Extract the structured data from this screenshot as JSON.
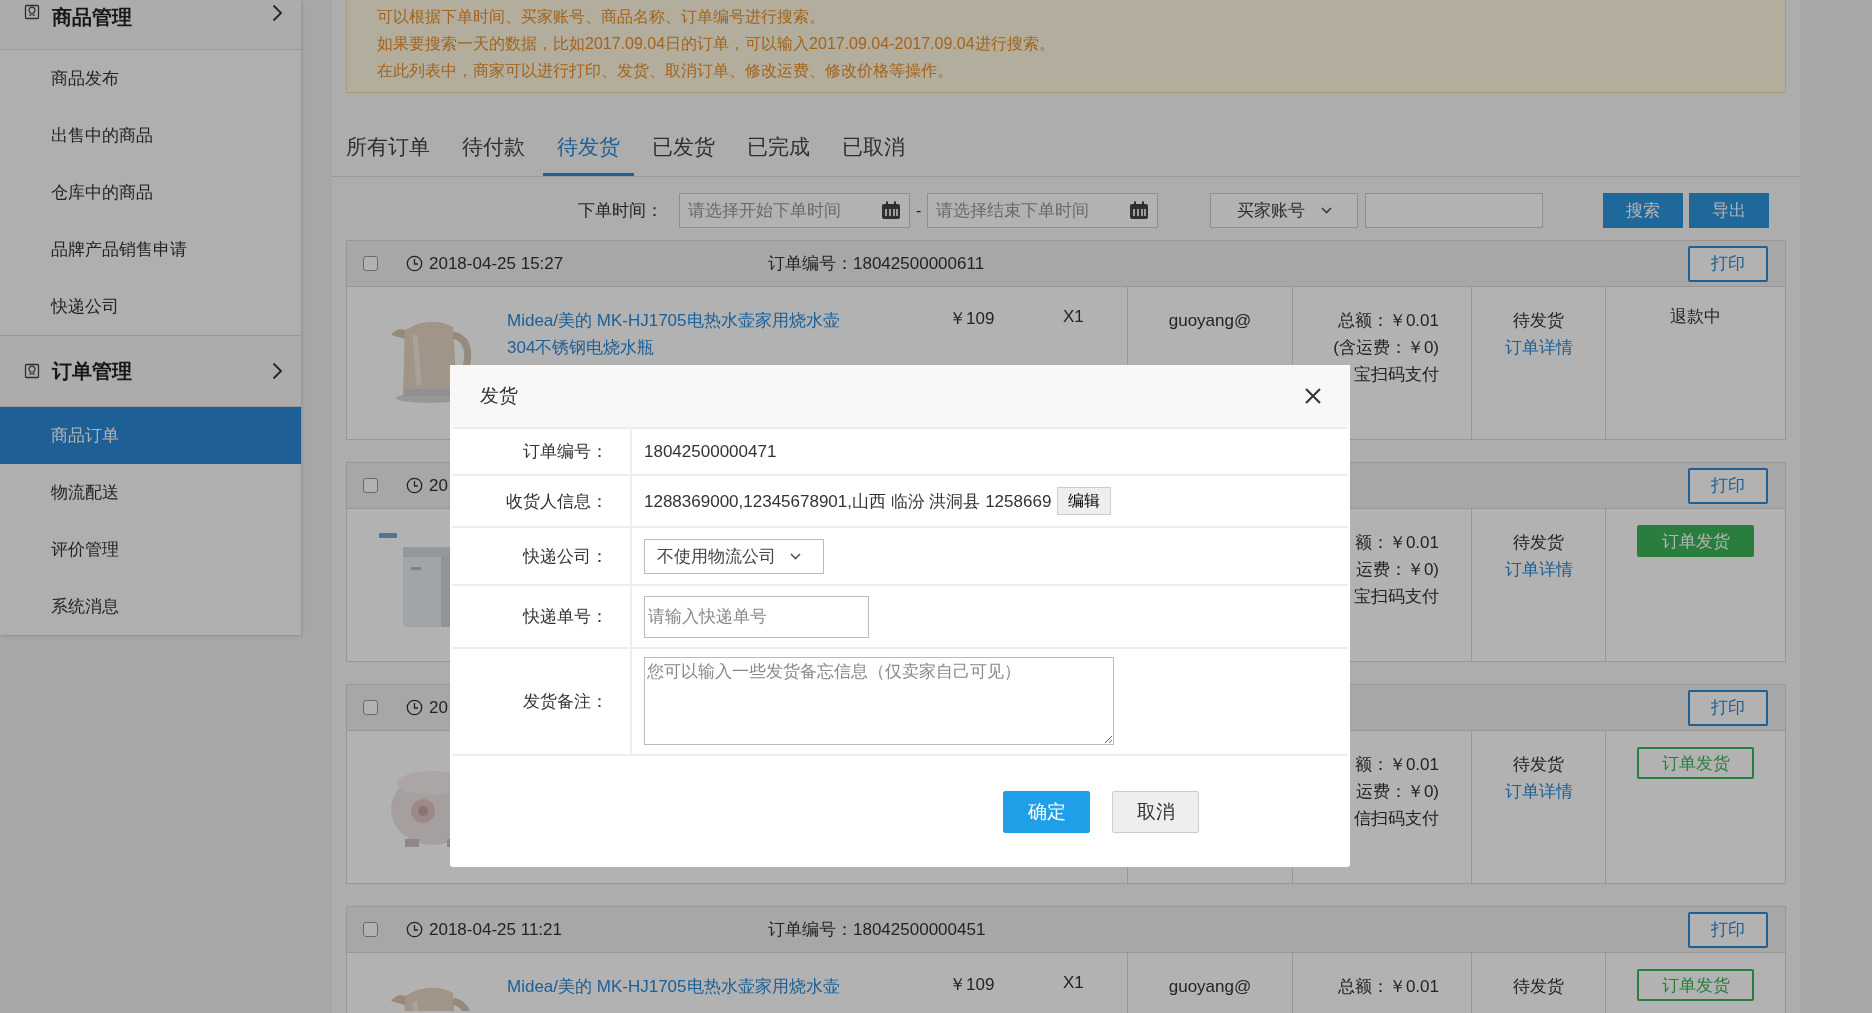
{
  "sidebar": {
    "groups": [
      {
        "title": "商品管理",
        "items": [
          {
            "label": "商品发布",
            "selected": false
          },
          {
            "label": "出售中的商品",
            "selected": false
          },
          {
            "label": "仓库中的商品",
            "selected": false
          },
          {
            "label": "品牌产品销售申请",
            "selected": false
          },
          {
            "label": "快递公司",
            "selected": false
          }
        ]
      },
      {
        "title": "订单管理",
        "items": [
          {
            "label": "商品订单",
            "selected": true
          },
          {
            "label": "物流配送",
            "selected": false
          },
          {
            "label": "评价管理",
            "selected": false
          },
          {
            "label": "系统消息",
            "selected": false
          }
        ]
      }
    ]
  },
  "notice": {
    "lines": [
      "可以根据下单时间、买家账号、商品名称、订单编号进行搜索。",
      "如果要搜索一天的数据，比如2017.09.04日的订单，可以输入2017.09.04-2017.09.04进行搜索。",
      "在此列表中，商家可以进行打印、发货、取消订单、修改运费、修改价格等操作。"
    ]
  },
  "tabs": [
    {
      "label": "所有订单",
      "selected": false
    },
    {
      "label": "待付款",
      "selected": false
    },
    {
      "label": "待发货",
      "selected": true
    },
    {
      "label": "已发货",
      "selected": false
    },
    {
      "label": "已完成",
      "selected": false
    },
    {
      "label": "已取消",
      "selected": false
    }
  ],
  "filter": {
    "label": "下单时间：",
    "start_placeholder": "请选择开始下单时间",
    "separator": "-",
    "end_placeholder": "请选择结束下单时间",
    "buyer_select": "买家账号",
    "buttons": [
      "搜索",
      "导出"
    ]
  },
  "orders": [
    {
      "checked": false,
      "time": "2018-04-25 15:27",
      "order_no": "订单编号：18042500000611",
      "print": "打印",
      "image": {
        "kind": "picture"
      },
      "title_lines": [
        "Midea/美的 MK-HJ1705电热水壶家用烧水壶",
        "304不锈钢电烧水瓶"
      ],
      "price": "￥109",
      "qty": "X1",
      "buyer": "guoyang@",
      "amount": [
        "总额：￥0.01",
        "(含运费：￥0)",
        "宝扫码支付"
      ],
      "status": "待发货",
      "detail": "订单详情",
      "action": {
        "kind": "text",
        "label": "退款中"
      }
    },
    {
      "checked": false,
      "time": "20",
      "print": "打印",
      "image": {
        "kind": "picture"
      },
      "amount": [
        "额：￥0.01",
        "运费：￥0)",
        "宝扫码支付"
      ],
      "status": "待发货",
      "detail": "订单详情",
      "action": {
        "kind": "button",
        "label": "订单发货",
        "filled": true
      }
    },
    {
      "checked": false,
      "time": "20",
      "print": "打印",
      "image": {
        "kind": "picture"
      },
      "amount": [
        "额：￥0.01",
        "运费：￥0)",
        "信扫码支付"
      ],
      "status": "待发货",
      "detail": "订单详情",
      "action": {
        "kind": "button",
        "label": "订单发货",
        "filled": false
      }
    },
    {
      "checked": false,
      "time": "2018-04-25 11:21",
      "order_no": "订单编号：18042500000451",
      "print": "打印",
      "image": {
        "kind": "picture"
      },
      "title_lines": [
        "Midea/美的 MK-HJ1705电热水壶家用烧水壶"
      ],
      "price": "￥109",
      "qty": "X1",
      "buyer": "guoyang@",
      "amount": [
        "总额：￥0.01"
      ],
      "status": "待发货",
      "action": {
        "kind": "button",
        "label": "订单发货",
        "filled": false
      }
    }
  ],
  "dialog": {
    "title": "发货",
    "fields": [
      {
        "kind": "text",
        "label": "订单编号：",
        "value": "18042500000471"
      },
      {
        "kind": "text",
        "label": "收货人信息：",
        "value": "1288369000,12345678901,山西 临汾 洪洞县 1258669",
        "button": "编辑"
      },
      {
        "kind": "select",
        "label": "快递公司：",
        "value": "不使用物流公司"
      },
      {
        "kind": "input",
        "label": "快递单号：",
        "placeholder": "请输入快递单号"
      },
      {
        "kind": "textarea",
        "label": "发货备注：",
        "placeholder": "您可以输入一些发货备忘信息（仅卖家自己可见）"
      }
    ],
    "buttons": [
      {
        "label": "确定",
        "primary": true
      },
      {
        "label": "取消",
        "primary": false
      }
    ]
  }
}
